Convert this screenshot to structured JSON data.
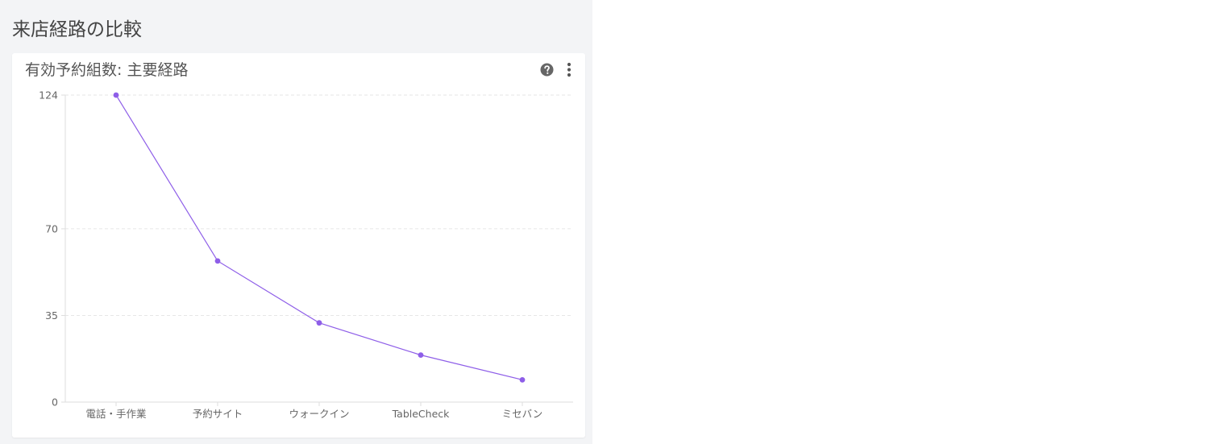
{
  "section": {
    "title": "来店経路の比較"
  },
  "card": {
    "title": "有効予約組数: 主要経路",
    "help_icon": "question-circle-icon",
    "menu_icon": "kebab-menu-icon"
  },
  "colors": {
    "series": "#8e5ee8",
    "grid": "#e6e6e6",
    "axis": "#dddddd"
  },
  "chart_data": {
    "type": "line",
    "categories": [
      "電話・手作業",
      "予約サイト",
      "ウォークイン",
      "TableCheck",
      "ミセバン"
    ],
    "values": [
      124,
      57,
      32,
      19,
      9
    ],
    "yticks": [
      0,
      35,
      70,
      124
    ],
    "ylim": [
      0,
      124
    ],
    "grid": true,
    "legend": "none"
  }
}
